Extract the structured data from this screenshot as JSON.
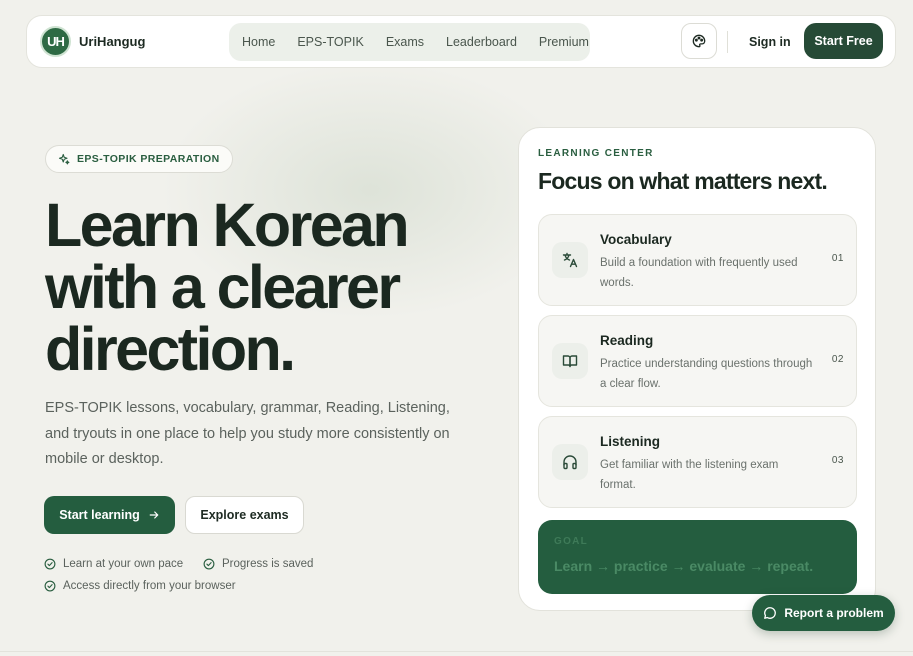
{
  "nav": {
    "logo_mark": "UH",
    "brand": "UriHangug",
    "links": [
      "Home",
      "EPS-TOPIK",
      "Exams",
      "Leaderboard",
      "Premium"
    ],
    "sign_in": "Sign in",
    "start_free": "Start Free"
  },
  "hero": {
    "badge": "EPS-TOPIK PREPARATION",
    "title_lines": [
      "Learn Korean",
      "with a clearer",
      "direction."
    ],
    "description": "EPS-TOPIK lessons, vocabulary, grammar, Reading, Listening, and tryouts in one place to help you study more consistently on mobile or desktop.",
    "primary_button": "Start learning",
    "secondary_button": "Explore exams",
    "features": [
      "Learn at your own pace",
      "Progress is saved",
      "Access directly from your browser"
    ]
  },
  "learning_center": {
    "eyebrow": "LEARNING CENTER",
    "title": "Focus on what matters next.",
    "items": [
      {
        "title": "Vocabulary",
        "description": "Build a foundation with frequently used words.",
        "number": "01",
        "icon": "translate-icon"
      },
      {
        "title": "Reading",
        "description": "Practice understanding questions through a clear flow.",
        "number": "02",
        "icon": "book-icon"
      },
      {
        "title": "Listening",
        "description": "Get familiar with the listening exam format.",
        "number": "03",
        "icon": "headphones-icon"
      }
    ],
    "goal_label": "GOAL",
    "goal_text": "Learn → practice → evaluate → repeat."
  },
  "report_button": "Report a problem",
  "colors": {
    "primary": "#245d3f",
    "dark": "#264a36",
    "background": "#f1f1ec",
    "text": "#1b2820"
  }
}
